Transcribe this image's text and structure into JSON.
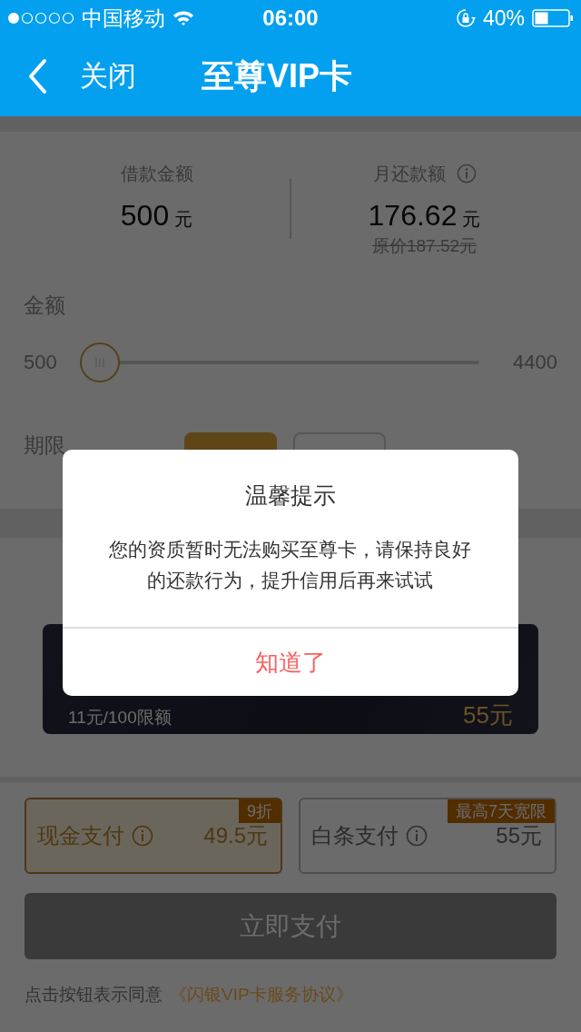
{
  "status_bar": {
    "carrier": "中国移动",
    "time": "06:00",
    "battery": "40%"
  },
  "nav": {
    "back_label": "关闭",
    "title": "至尊VIP卡"
  },
  "summary": {
    "loan_label": "借款金额",
    "loan_amount": "500",
    "loan_unit": "元",
    "monthly_label": "月还款额",
    "monthly_amount": "176.62",
    "monthly_unit": "元",
    "original_price": "原价187.52元"
  },
  "amount": {
    "label": "金额",
    "min": "500",
    "max": "4400",
    "level": 0
  },
  "term": {
    "label": "期限",
    "options": [
      {
        "selected": true
      },
      {
        "selected": false
      }
    ]
  },
  "vip_card": {
    "quota": "11元/100限额",
    "price": "55元"
  },
  "payment": {
    "options": [
      {
        "label": "现金支付",
        "price": "49.5元",
        "badge": "9折",
        "selected": true
      },
      {
        "label": "白条支付",
        "price": "55元",
        "badge": "最高7天宽限",
        "selected": false
      }
    ],
    "pay_button": {
      "label": "立即支付",
      "disabled": true
    },
    "agreement": {
      "text": "点击按钮表示同意",
      "link": "《闪银VIP卡服务协议》"
    }
  },
  "dialog": {
    "title": "温馨提示",
    "message": "您的资质暂时无法购买至尊卡，请保持良好的还款行为，提升信用后再来试试",
    "button": "知道了"
  }
}
